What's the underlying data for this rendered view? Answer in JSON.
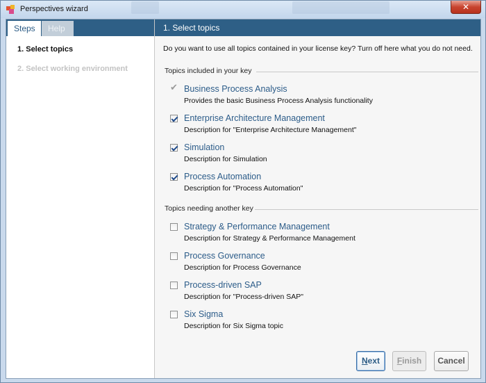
{
  "window": {
    "title": "Perspectives wizard",
    "close_glyph": "✕",
    "app_icon": "wizard-app-icon"
  },
  "left_panel": {
    "tabs": [
      {
        "label": "Steps",
        "active": true
      },
      {
        "label": "Help",
        "active": false
      }
    ],
    "steps": [
      {
        "label": "1. Select topics",
        "state": "current"
      },
      {
        "label": "2. Select working environment",
        "state": "disabled"
      }
    ]
  },
  "right_panel": {
    "header": "1. Select topics",
    "question": "Do you want to use all topics contained in your license key? Turn off here what you do not need.",
    "groups": [
      {
        "label": "Topics included in your key",
        "topics": [
          {
            "name": "Business Process Analysis",
            "description": "Provides the basic Business Process Analysis functionality",
            "checked": true,
            "locked": true
          },
          {
            "name": "Enterprise Architecture Management",
            "description": "Description for \"Enterprise Architecture Management\"",
            "checked": true,
            "locked": false
          },
          {
            "name": "Simulation",
            "description": "Description for Simulation",
            "checked": true,
            "locked": false
          },
          {
            "name": "Process Automation",
            "description": "Description for \"Process Automation\"",
            "checked": true,
            "locked": false
          }
        ]
      },
      {
        "label": "Topics needing another key",
        "topics": [
          {
            "name": "Strategy & Performance Management",
            "description": "Description for Strategy & Performance Management",
            "checked": false,
            "locked": false
          },
          {
            "name": "Process Governance",
            "description": "Description for Process Governance",
            "checked": false,
            "locked": false
          },
          {
            "name": "Process-driven SAP",
            "description": "Description for \"Process-driven SAP\"",
            "checked": false,
            "locked": false
          },
          {
            "name": "Six Sigma",
            "description": "Description for Six Sigma topic",
            "checked": false,
            "locked": false
          }
        ]
      }
    ]
  },
  "buttons": {
    "next": {
      "mnemonic": "N",
      "rest": "ext",
      "enabled": true
    },
    "finish": {
      "mnemonic": "F",
      "rest": "inish",
      "enabled": false
    },
    "cancel": {
      "label": "Cancel",
      "enabled": true
    }
  },
  "colors": {
    "header_blue": "#2e5f86",
    "topic_link": "#2c5c89"
  }
}
